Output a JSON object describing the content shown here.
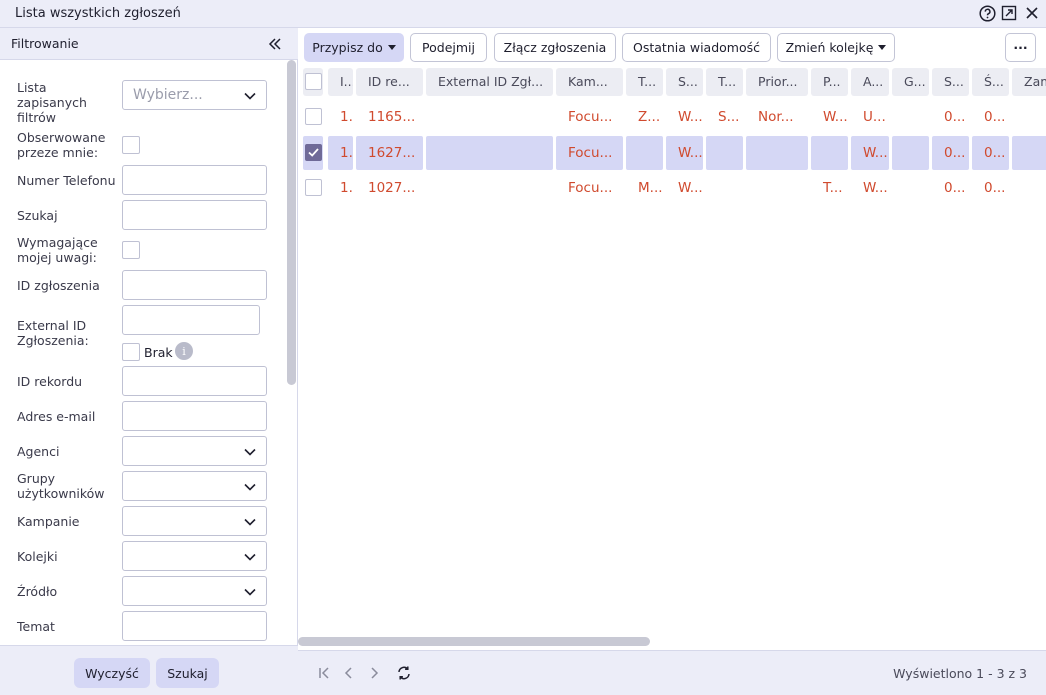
{
  "window": {
    "title": "Lista wszystkich zgłoszeń"
  },
  "filter": {
    "header": "Filtrowanie",
    "saved_filters_label": "Lista zapisanych filtrów",
    "saved_filters_placeholder": "Wybierz...",
    "observed_label": "Obserwowane przeze mnie:",
    "phone_label": "Numer Telefonu",
    "search_label": "Szukaj",
    "attention_label": "Wymagające mojej uwagi:",
    "ticket_id_label": "ID zgłoszenia",
    "external_id_label": "External ID Zgłoszenia:",
    "none_label": "Brak",
    "info_glyph": "i",
    "record_id_label": "ID rekordu",
    "email_label": "Adres e-mail",
    "agents_label": "Agenci",
    "user_groups_label": "Grupy użytkowników",
    "campaigns_label": "Kampanie",
    "queues_label": "Kolejki",
    "source_label": "Źródło",
    "subject_label": "Temat",
    "clear_button": "Wyczyść",
    "search_button": "Szukaj"
  },
  "toolbar": {
    "assign": "Przypisz do",
    "take": "Podejmij",
    "merge": "Złącz zgłoszenia",
    "last_message": "Ostatnia wiadomość",
    "change_queue": "Zmień kolejkę",
    "more": "···"
  },
  "grid": {
    "columns": [
      "I...",
      "ID re...",
      "External ID Zgł...",
      "Kam...",
      "T...",
      "S...",
      "T...",
      "Prior...",
      "P...",
      "A...",
      "G...",
      "S...",
      "Ś...",
      "Zam"
    ],
    "rows": [
      {
        "selected": false,
        "cells": [
          "1...",
          "1165...",
          "",
          "Focu...",
          "Z...",
          "W...",
          "S...",
          "Nor...",
          "W...",
          "U...",
          "",
          "0...",
          "0...",
          ""
        ]
      },
      {
        "selected": true,
        "cells": [
          "1...",
          "1627...",
          "",
          "Focu...",
          "",
          "W...",
          "",
          "",
          "",
          "W...",
          "",
          "0...",
          "0...",
          ""
        ]
      },
      {
        "selected": false,
        "cells": [
          "1...",
          "1027...",
          "",
          "Focu...",
          "M...",
          "W...",
          "",
          "",
          "T...",
          "W...",
          "",
          "0...",
          "0...",
          ""
        ]
      }
    ]
  },
  "pager": {
    "count_text": "Wyświetlono 1 - 3 z 3"
  },
  "colors": {
    "accent": "#d5d7f5",
    "cell_text": "#d04a2e",
    "check": "#6f6a98"
  }
}
